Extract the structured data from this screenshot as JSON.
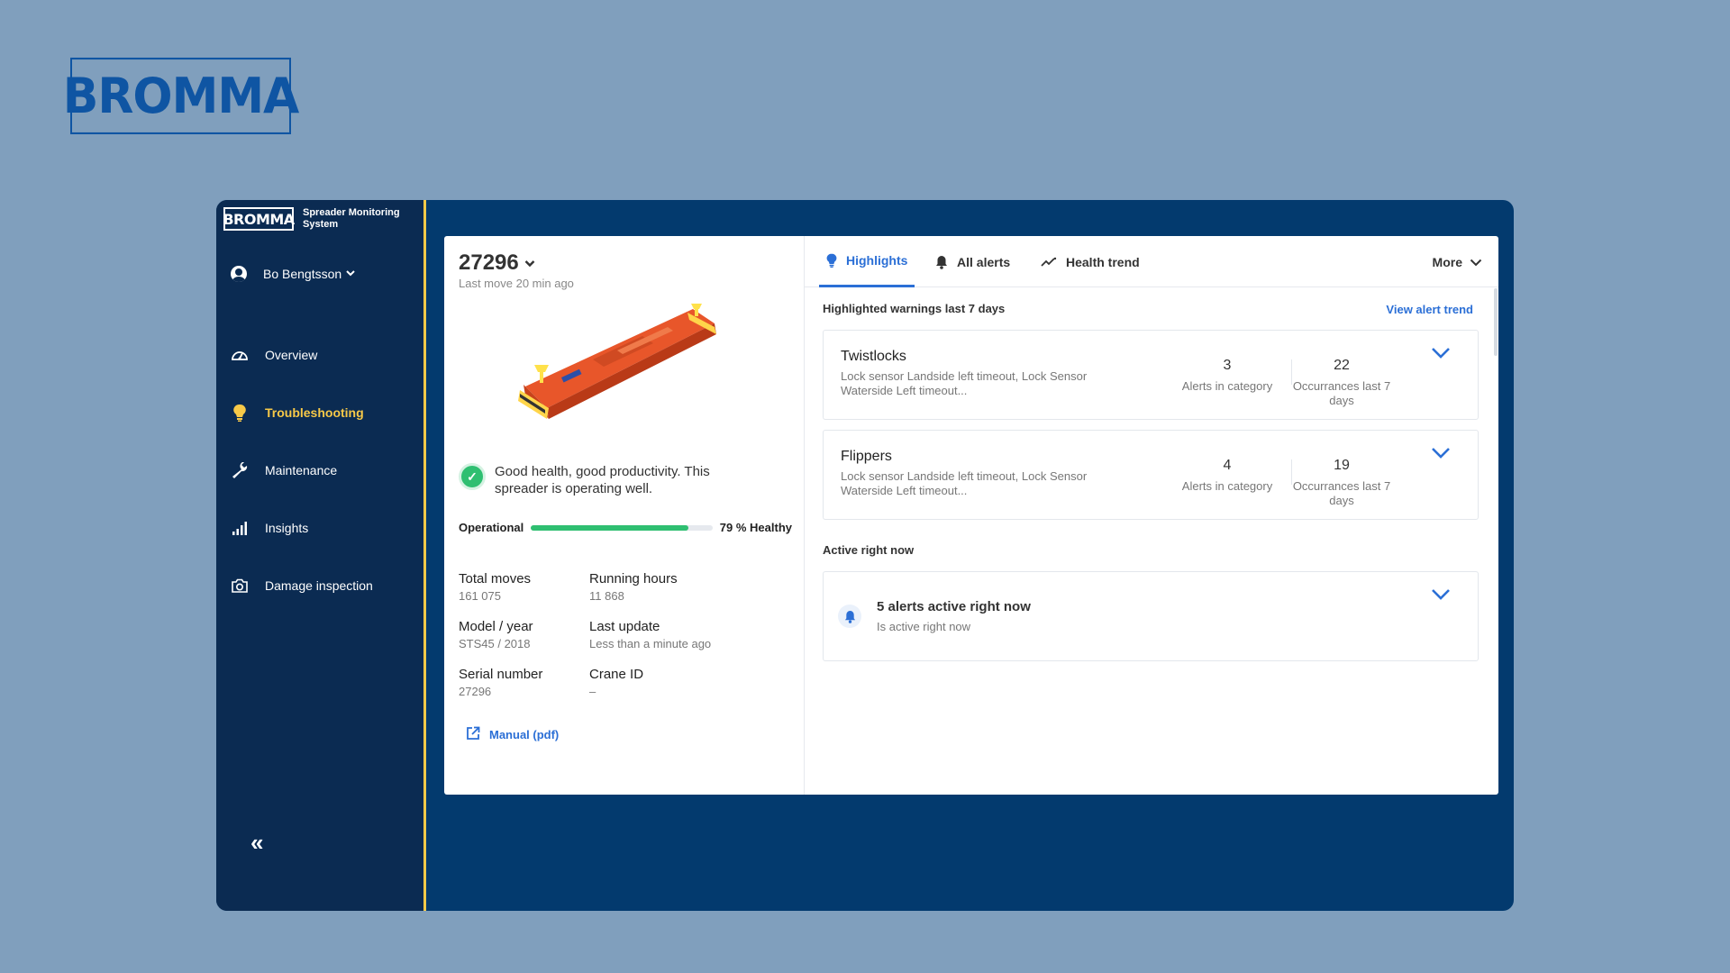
{
  "brand": {
    "logo": "BROMMA"
  },
  "sidebar": {
    "logo": "BROMMA",
    "app_title": "Spreader Monitoring System",
    "user": "Bo Bengtsson",
    "items": [
      {
        "label": "Overview",
        "icon": "gauge-icon"
      },
      {
        "label": "Troubleshooting",
        "icon": "lightbulb-icon"
      },
      {
        "label": "Maintenance",
        "icon": "wrench-icon"
      },
      {
        "label": "Insights",
        "icon": "bar-signal-icon"
      },
      {
        "label": "Damage inspection",
        "icon": "camera-icon"
      }
    ],
    "collapse_label": "«"
  },
  "unit": {
    "id": "27296",
    "last_move": "Last move 20 min ago",
    "health_text": "Good health, good productivity. This spreader is operating well.",
    "status_label": "Operational",
    "health_pct": 79,
    "health_label": "79 % Healthy"
  },
  "specs": [
    {
      "key": "Total moves",
      "value": "161 075"
    },
    {
      "key": "Running hours",
      "value": "11 868"
    },
    {
      "key": "Model / year",
      "value": "STS45 / 2018"
    },
    {
      "key": "Last update",
      "value": "Less than a minute ago"
    },
    {
      "key": "Serial number",
      "value": "27296"
    },
    {
      "key": "Crane ID",
      "value": "–"
    }
  ],
  "manual_label": "Manual (pdf)",
  "tabs": [
    {
      "label": "Highlights",
      "icon": "lightbulb-icon"
    },
    {
      "label": "All alerts",
      "icon": "bell-icon"
    },
    {
      "label": "Health trend",
      "icon": "trend-icon"
    }
  ],
  "more_label": "More",
  "highlights": {
    "section_title": "Highlighted warnings last 7 days",
    "view_trend": "View alert trend",
    "cards": [
      {
        "name": "Twistlocks",
        "desc": "Lock sensor Landside left timeout, Lock Sensor Waterside Left timeout...",
        "alerts": "3",
        "alerts_label": "Alerts in category",
        "occ": "22",
        "occ_label": "Occurrances last 7 days"
      },
      {
        "name": "Flippers",
        "desc": "Lock sensor Landside left timeout, Lock Sensor Waterside Left timeout...",
        "alerts": "4",
        "alerts_label": "Alerts in category",
        "occ": "19",
        "occ_label": "Occurrances last 7 days"
      }
    ]
  },
  "active": {
    "section_title": "Active right now",
    "title": "5 alerts active right now",
    "sub": "Is active right now"
  }
}
